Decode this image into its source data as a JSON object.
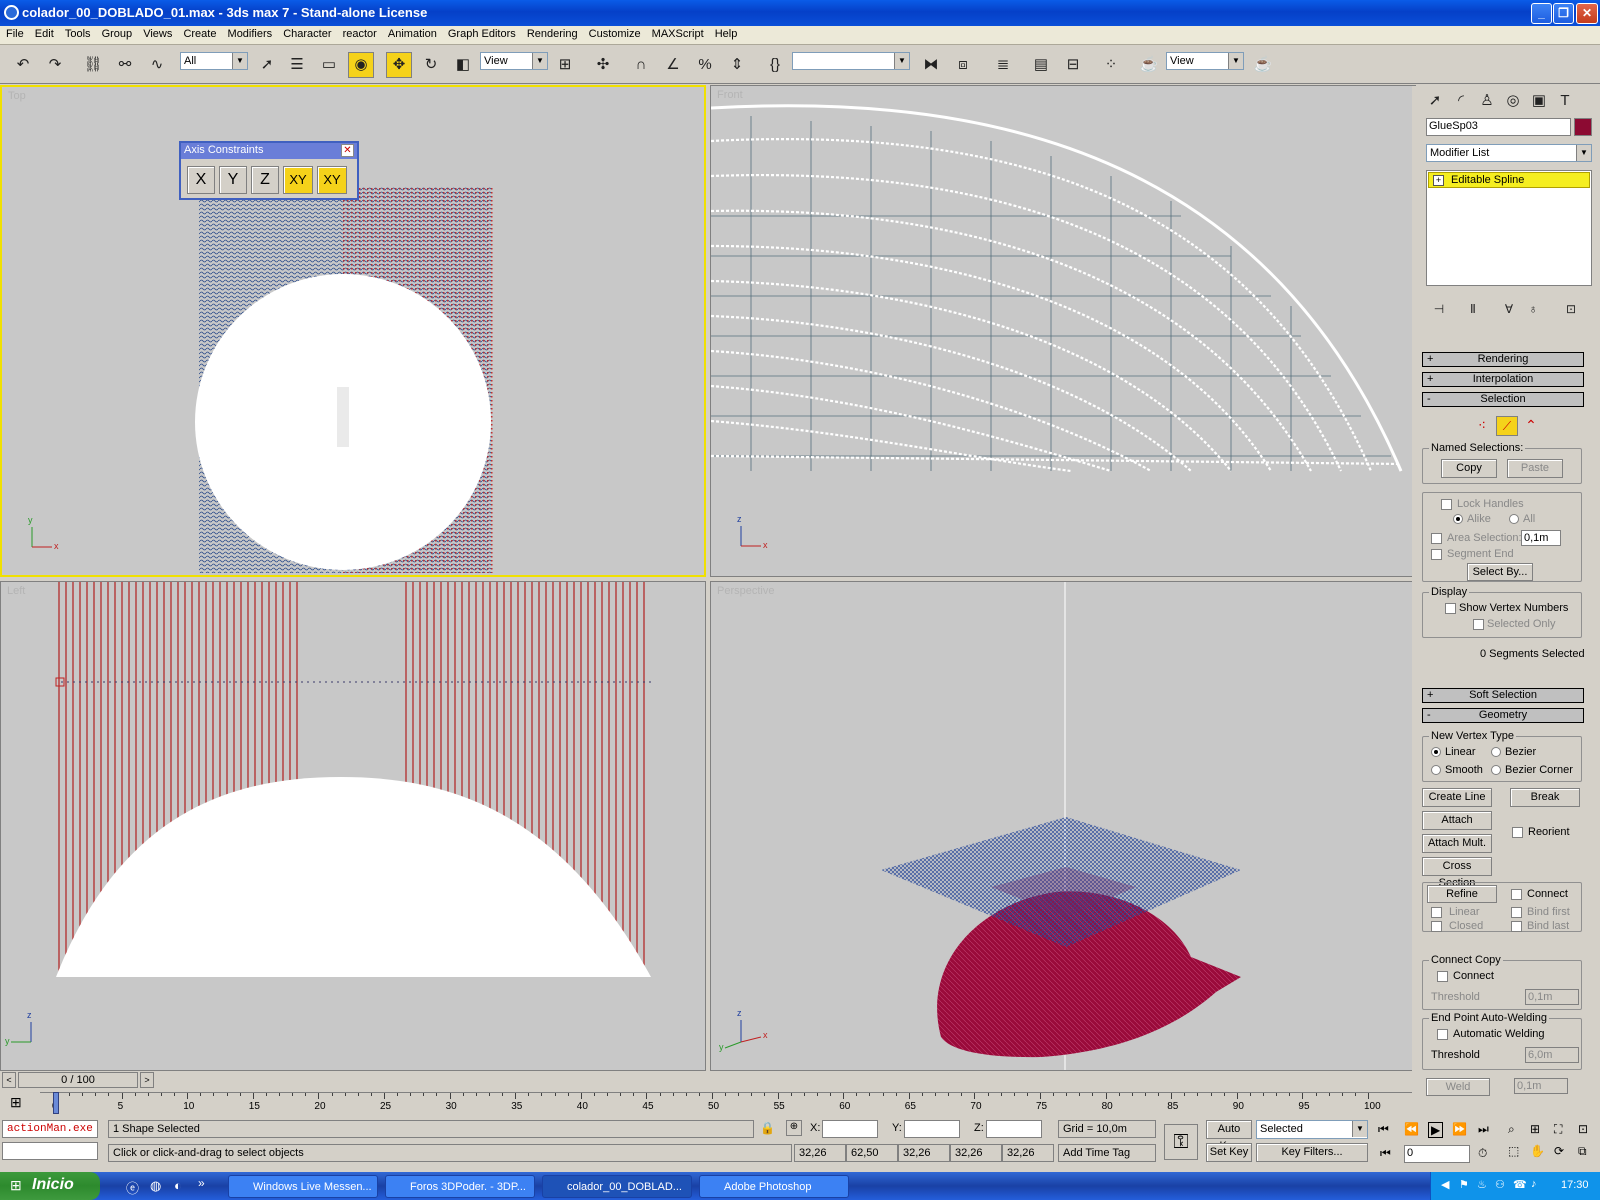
{
  "window": {
    "title": "colador_00_DOBLADO_01.max - 3ds max 7  - Stand-alone License"
  },
  "menu": [
    "File",
    "Edit",
    "Tools",
    "Group",
    "Views",
    "Create",
    "Modifiers",
    "Character",
    "reactor",
    "Animation",
    "Graph Editors",
    "Rendering",
    "Customize",
    "MAXScript",
    "Help"
  ],
  "toolbar": {
    "selection_filter": "All",
    "ref_coord": "View",
    "ref_coord2": "View",
    "named_selection": ""
  },
  "axis_constraints": {
    "title": "Axis Constraints",
    "buttons": [
      "X",
      "Y",
      "Z",
      "XY",
      "XY"
    ]
  },
  "viewports": {
    "top": "Top",
    "front": "Front",
    "left": "Left",
    "perspective": "Perspective"
  },
  "command_panel": {
    "object_name": "GlueSp03",
    "object_color": "#8c0a32",
    "modifier_list": "Modifier List",
    "stack_item": "Editable Spline",
    "rollouts": {
      "rendering": "Rendering",
      "interpolation": "Interpolation",
      "selection": "Selection",
      "soft_selection": "Soft Selection",
      "geometry": "Geometry"
    },
    "signs": {
      "plus": "+",
      "minus": "-"
    },
    "selection": {
      "named_selections": "Named Selections:",
      "copy": "Copy",
      "paste": "Paste",
      "lock_handles": "Lock Handles",
      "alike": "Alike",
      "all": "All",
      "area_selection": "Area Selection:",
      "area_value": "0,1m",
      "segment_end": "Segment End",
      "select_by": "Select By...",
      "display": "Display",
      "show_vertex_numbers": "Show Vertex Numbers",
      "selected_only": "Selected Only",
      "status": "0 Segments Selected"
    },
    "geometry": {
      "new_vertex_type": "New Vertex Type",
      "linear": "Linear",
      "bezier": "Bezier",
      "smooth": "Smooth",
      "bezier_corner": "Bezier Corner",
      "create_line": "Create Line",
      "break": "Break",
      "attach": "Attach",
      "reorient": "Reorient",
      "attach_mult": "Attach Mult.",
      "cross_section": "Cross Section",
      "refine": "Refine",
      "connect": "Connect",
      "linear2": "Linear",
      "bind_first": "Bind first",
      "closed": "Closed",
      "bind_last": "Bind last",
      "connect_copy": "Connect Copy",
      "connect2": "Connect",
      "threshold": "Threshold",
      "threshold_value": "0,1m",
      "end_point_welding": "End Point Auto-Welding",
      "automatic_welding": "Automatic Welding",
      "threshold2": "Threshold",
      "threshold2_value": "6,0m",
      "weld": "Weld",
      "weld_value": "0,1m"
    }
  },
  "timeline": {
    "frame_display": "0 / 100",
    "ticks": [
      "0",
      "5",
      "10",
      "15",
      "20",
      "25",
      "30",
      "35",
      "40",
      "45",
      "50",
      "55",
      "60",
      "65",
      "70",
      "75",
      "80",
      "85",
      "90",
      "95",
      "100"
    ]
  },
  "status": {
    "maxscript": "actionMan.exe",
    "selection": "1 Shape Selected",
    "prompt": "Click or click-and-drag to select objects",
    "x_label": "X:",
    "y_label": "Y:",
    "z_label": "Z:",
    "grid": "Grid = 10,0m",
    "coords": [
      "32,26",
      "62,50",
      "32,26",
      "32,26",
      "32,26"
    ],
    "add_time_tag": "Add Time Tag",
    "auto_key": "Auto Key",
    "set_key": "Set Key",
    "key_mode": "Selected",
    "key_filters": "Key Filters...",
    "frame": "0"
  },
  "taskbar": {
    "start": "Inicio",
    "tasks": [
      "Windows Live Messen...",
      "Foros 3DPoder. - 3DP...",
      "colador_00_DOBLAD...",
      "Adobe Photoshop"
    ],
    "clock": "17:30"
  }
}
